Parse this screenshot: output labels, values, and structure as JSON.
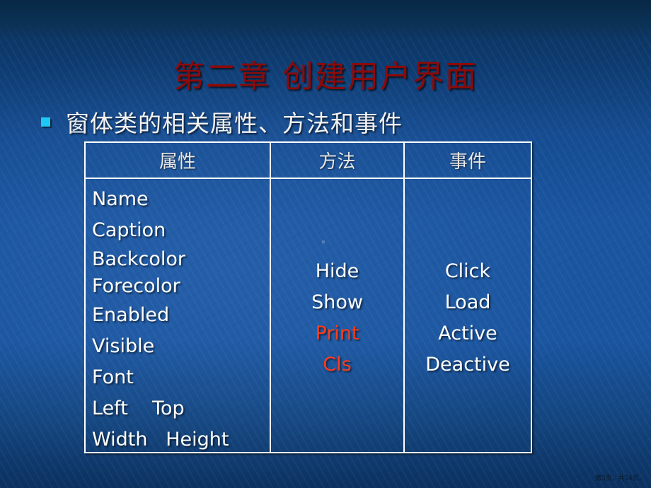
{
  "slide": {
    "title": "第二章  创建用户界面",
    "bullet_icon": "square-bullet",
    "bullet_text": "窗体类的相关属性、方法和事件",
    "bullet_color": "#1ec8f5",
    "title_color": "#8b0a0a",
    "highlight_color": "#ff3b1a"
  },
  "table": {
    "headers": [
      "属性",
      "方法",
      "事件"
    ],
    "properties": [
      "Name",
      "Caption",
      "Backcolor",
      "Forecolor",
      "Enabled",
      "Visible",
      "Font",
      "Left    Top",
      "Width   Height"
    ],
    "methods": [
      {
        "label": "Hide",
        "highlight": false
      },
      {
        "label": "Show",
        "highlight": false
      },
      {
        "label": "Print",
        "highlight": true
      },
      {
        "label": "Cls",
        "highlight": true
      }
    ],
    "events": [
      "Click",
      "Load",
      "Active",
      "Deactive"
    ]
  },
  "footer": {
    "page_indicator": "第3页，共54页。"
  }
}
